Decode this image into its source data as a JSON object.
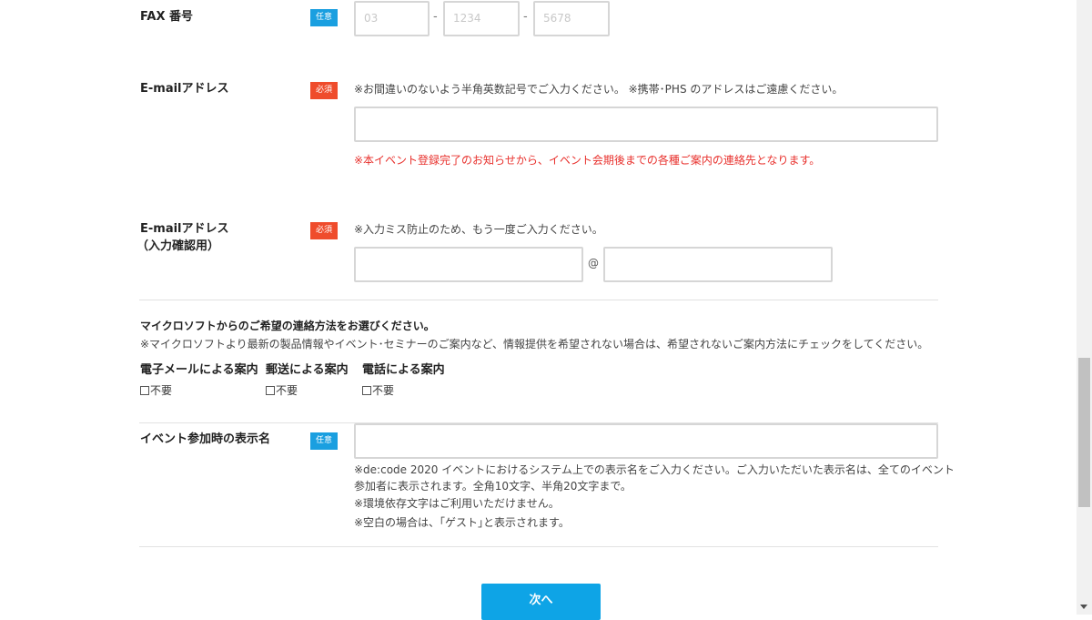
{
  "fax": {
    "label": "FAX 番号",
    "badge": "任意",
    "fields": [
      "03",
      "1234",
      "5678"
    ],
    "separator": "-"
  },
  "email": {
    "label": "E-mailアドレス",
    "badge": "必須",
    "note": "※お間違いのないよう半角英数記号でご入力ください。 ※携帯･PHS のアドレスはご遠慮ください。",
    "value": "",
    "warning": "※本イベント登録完了のお知らせから、イベント会期後までの各種ご案内の連絡先となります。"
  },
  "email_confirm": {
    "label_line1": "E-mailアドレス",
    "label_line2": "（入力確認用）",
    "badge": "必須",
    "note": "※入力ミス防止のため、もう一度ご入力ください。",
    "at": "@",
    "local_value": "",
    "domain_value": ""
  },
  "contact": {
    "title": "マイクロソフトからのご希望の連絡方法をお選びください。",
    "subtitle": "※マイクロソフトより最新の製品情報やイベント･セミナーのご案内など、情報提供を希望されない場合は、希望されないご案内方法にチェックをしてください。",
    "options": [
      {
        "heading": "電子メールによる案内",
        "checkbox_label": "不要",
        "checked": false
      },
      {
        "heading": "郵送による案内",
        "checkbox_label": "不要",
        "checked": false
      },
      {
        "heading": "電話による案内",
        "checkbox_label": "不要",
        "checked": false
      }
    ]
  },
  "display_name": {
    "label": "イベント参加時の表示名",
    "badge": "任意",
    "value": "",
    "note_line1": "※de:code 2020 イベントにおけるシステム上での表示名をご入力ください。ご入力いただいた表示名は、全てのイベント",
    "note_line2": "参加者に表示されます。全角10文字、半角20文字まで。",
    "note_line3": "※環境依存文字はご利用いただけません。",
    "note_line4": "※空白の場合は、｢ゲスト｣と表示されます。"
  },
  "next_button": "次へ",
  "colors": {
    "badge_optional": "#1a9fe0",
    "badge_required": "#ef4c2c",
    "warning_text": "#e8302c",
    "button": "#0ea4e6"
  }
}
